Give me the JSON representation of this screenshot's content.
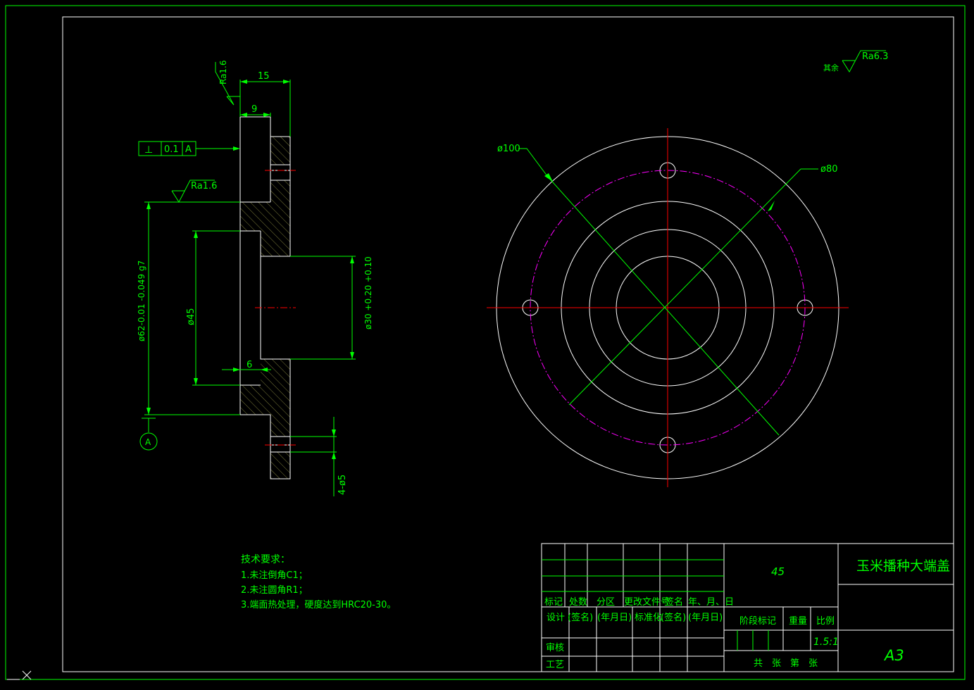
{
  "drawing": {
    "roughness_note": {
      "prefix": "其余",
      "value": "Ra6.3"
    },
    "section_view": {
      "dim_overall_width": "15",
      "dim_flange_step": "9",
      "dim_recess_depth": "6",
      "dim_bore_diameter": "ø45",
      "dim_register_diameter": "ø62-0.01 -0.049 g7",
      "dim_hub_bore": "ø30 +0.20 +0.10",
      "dim_holes": "4-ø5",
      "roughness_top": "Ra1.6",
      "roughness_face": "Ra1.6",
      "tolerance_frame": {
        "symbol": "⊥",
        "value": "0.1",
        "datum": "A"
      },
      "datum_label": "A"
    },
    "front_view": {
      "dim_outer": "ø100",
      "dim_bolt_circle": "ø80"
    },
    "tech_requirements": {
      "title": "技术要求：",
      "items": [
        "1.未注倒角C1；",
        "2.未注圆角R1；",
        "3.端面热处理，硬度达到HRC20-30。"
      ]
    }
  },
  "title_block": {
    "material": "45",
    "part_name": "玉米播种大端盖",
    "scale": "1.5:1",
    "sheet_size": "A3",
    "revision_headers": [
      "标记",
      "处数",
      "分区",
      "更改文件号",
      "签名",
      "年、月、日"
    ],
    "design_row": [
      "设计",
      "(签名)",
      "(年月日)",
      "标准化",
      "(签名)",
      "(年月日)"
    ],
    "stage_headers": [
      "阶段标记",
      "重量",
      "比例"
    ],
    "review_label": "审核",
    "process_label": "工艺",
    "sheet_count": "共　张　第　张"
  }
}
